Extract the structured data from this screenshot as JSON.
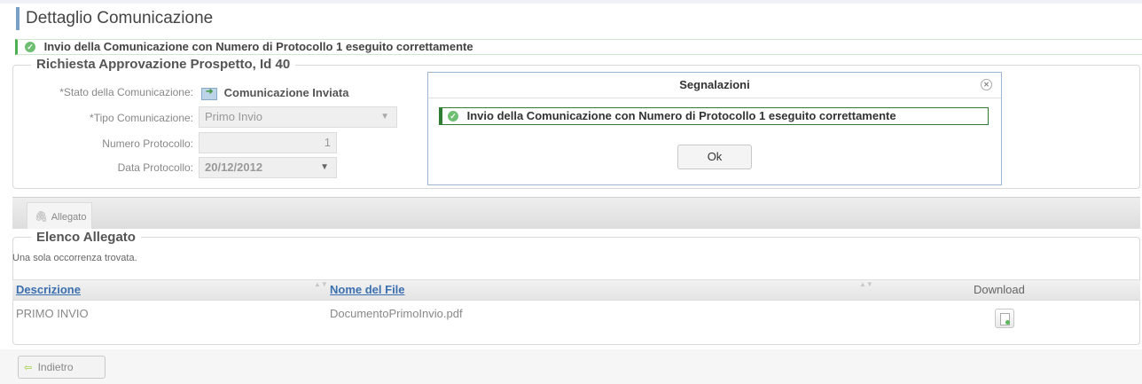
{
  "page": {
    "title": "Dettaglio Comunicazione",
    "success_message": "Invio della Comunicazione con Numero di Protocollo 1 eseguito correttamente"
  },
  "request_panel": {
    "legend": "Richiesta Approvazione Prospetto, Id 40",
    "stato_label": "*Stato della Comunicazione:",
    "stato_value": "Comunicazione Inviata",
    "tipo_label": "*Tipo Comunicazione:",
    "tipo_value": "Primo Invio",
    "numero_label": "Numero Protocollo:",
    "numero_value": "1",
    "data_label": "Data Protocollo:",
    "data_value": "20/12/2012"
  },
  "modal": {
    "title": "Segnalazioni",
    "message": "Invio della Comunicazione con Numero di Protocollo 1 eseguito correttamente",
    "ok_label": "Ok"
  },
  "tabs": [
    {
      "label": "Allegato"
    }
  ],
  "attachments": {
    "legend": "Elenco Allegato",
    "count_text": "Una sola occorrenza trovata.",
    "columns": [
      "Descrizione",
      "Nome del File",
      "Download"
    ],
    "rows": [
      {
        "descrizione": "PRIMO INVIO",
        "nome_file": "DocumentoPrimoInvio.pdf"
      }
    ]
  },
  "footer": {
    "back_label": "Indietro"
  },
  "colors": {
    "accent": "#7aa0c8",
    "success": "#4caf50",
    "link": "#3a6fb0"
  }
}
